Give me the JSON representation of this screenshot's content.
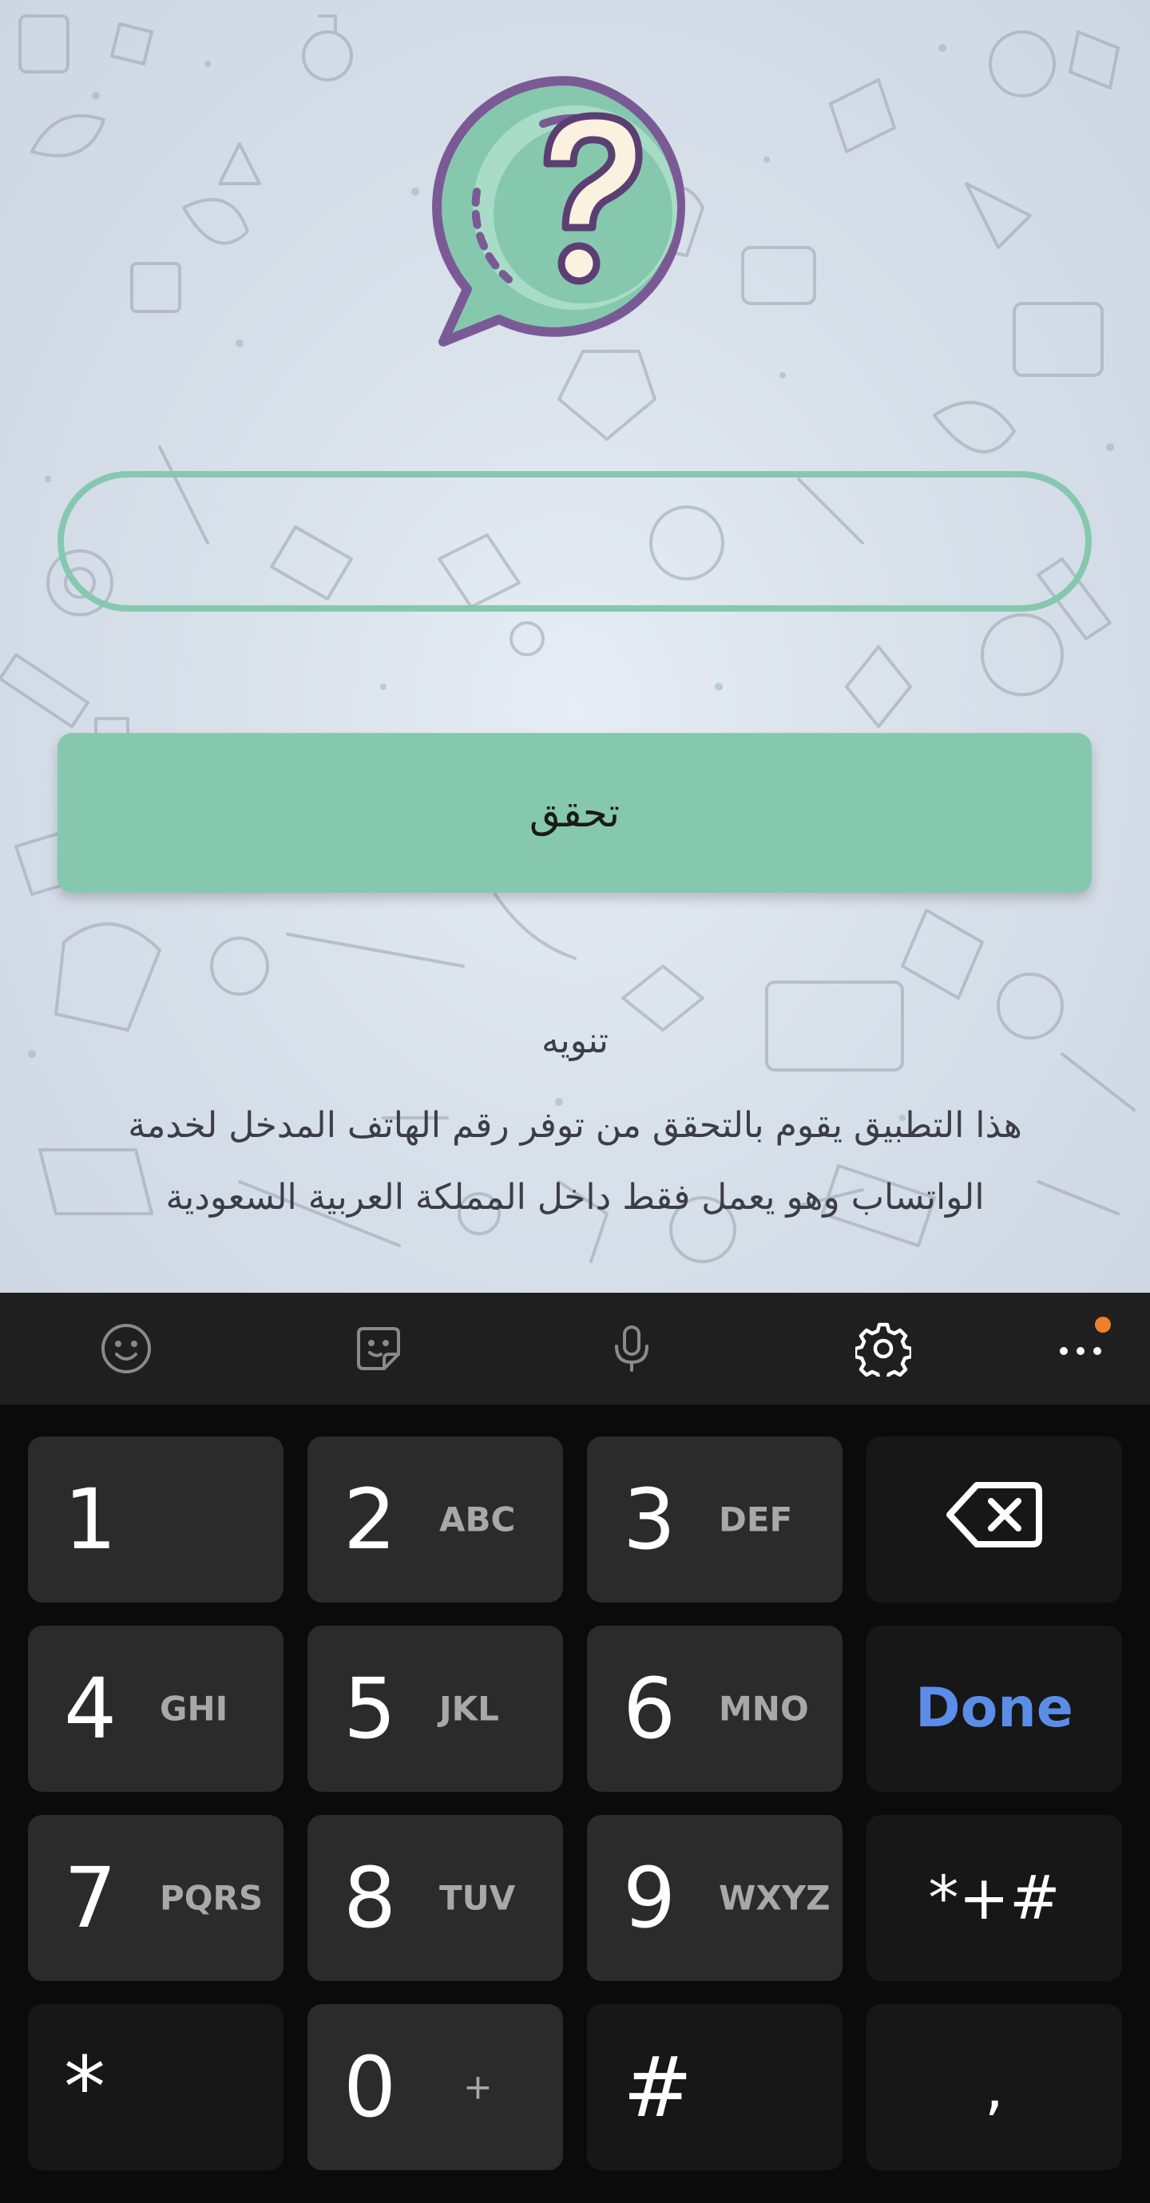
{
  "app": {
    "phone_input": {
      "value": "",
      "placeholder": ""
    },
    "verify_button_label": "تحقق",
    "notice": {
      "title": "تنويه",
      "line1": "هذا التطبيق يقوم بالتحقق من توفر رقم الهاتف المدخل لخدمة",
      "line2": "الواتساب وهو يعمل فقط داخل المملكة العربية السعودية"
    },
    "colors": {
      "accent": "#86c8ae",
      "logo_outline": "#7a5a95"
    }
  },
  "keyboard": {
    "toolbar": [
      {
        "icon": "emoji-icon"
      },
      {
        "icon": "sticker-icon"
      },
      {
        "icon": "microphone-icon"
      },
      {
        "icon": "settings-icon"
      },
      {
        "icon": "more-icon",
        "badge": true
      }
    ],
    "keys": {
      "k1": {
        "num": "1",
        "letters": ""
      },
      "k2": {
        "num": "2",
        "letters": "ABC"
      },
      "k3": {
        "num": "3",
        "letters": "DEF"
      },
      "k4": {
        "num": "4",
        "letters": "GHI"
      },
      "k5": {
        "num": "5",
        "letters": "JKL"
      },
      "k6": {
        "num": "6",
        "letters": "MNO"
      },
      "k7": {
        "num": "7",
        "letters": "PQRS"
      },
      "k8": {
        "num": "8",
        "letters": "TUV"
      },
      "k9": {
        "num": "9",
        "letters": "WXYZ"
      },
      "k0": {
        "num": "0",
        "letters": "+"
      },
      "done": "Done",
      "symbols": "*+#",
      "star": "*",
      "hash": "#",
      "comma": ","
    },
    "colors": {
      "done": "#5b8de8",
      "badge": "#f07f2c"
    }
  }
}
